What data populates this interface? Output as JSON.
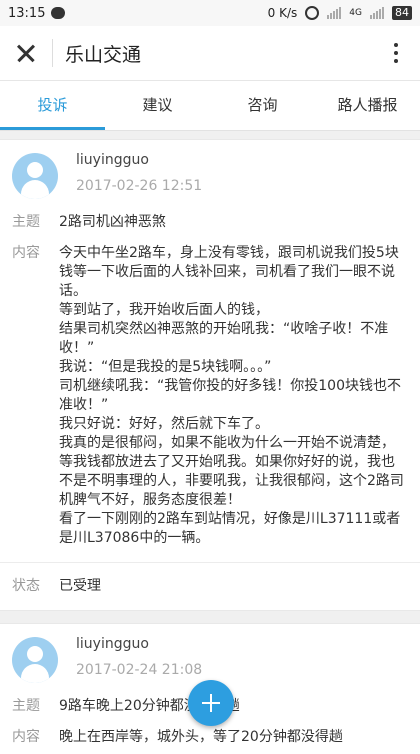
{
  "status_bar": {
    "time": "13:15",
    "net_speed": "0 K/s",
    "network": "4G",
    "battery": "84"
  },
  "app": {
    "title": "乐山交通"
  },
  "tabs": [
    {
      "label": "投诉",
      "active": true
    },
    {
      "label": "建议",
      "active": false
    },
    {
      "label": "咨询",
      "active": false
    },
    {
      "label": "路人播报",
      "active": false
    }
  ],
  "labels": {
    "subject": "主题",
    "content": "内容",
    "status": "状态"
  },
  "posts": [
    {
      "user": "liuyingguo",
      "time": "2017-02-26 12:51",
      "subject": "2路司机凶神恶煞",
      "content": "今天中午坐2路车，身上没有零钱，跟司机说我们投5块钱等一下收后面的人钱补回来，司机看了我们一眼不说话。\n等到站了，我开始收后面人的钱，\n结果司机突然凶神恶煞的开始吼我：“收啥子收！不准收！”\n我说：“但是我投的是5块钱啊。。。”\n司机继续吼我：“我管你投的好多钱！你投100块钱也不准收！”\n我只好说：好好，然后就下车了。\n我真的是很郁闷，如果不能收为什么一开始不说清楚，等我钱都放进去了又开始吼我。如果你好好的说，我也不是不明事理的人，非要吼我，让我很郁闷，这个2路司机脾气不好，服务态度很差！\n看了一下刚刚的2路车到站情况，好像是川L37111或者是川L37086中的一辆。",
      "status": "已受理"
    },
    {
      "user": "liuyingguo",
      "time": "2017-02-24 21:08",
      "subject": "9路车晚上20分钟都没得一趟",
      "content": "晚上在西岸等，城外头，等了20分钟都没得趟"
    }
  ],
  "colors": {
    "accent": "#2b9bd9",
    "avatar": "#9ecff0"
  },
  "icons": {
    "close": "close-icon",
    "more": "more-vert-icon",
    "fab": "plus-icon"
  }
}
